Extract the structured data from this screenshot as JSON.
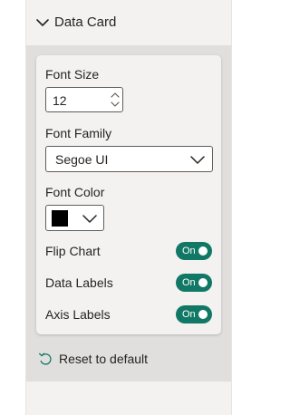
{
  "section": {
    "title": "Data Card",
    "expanded": true
  },
  "font_size": {
    "label": "Font Size",
    "value": "12"
  },
  "font_family": {
    "label": "Font Family",
    "value": "Segoe UI"
  },
  "font_color": {
    "label": "Font Color",
    "color": "#000000"
  },
  "toggles": [
    {
      "label": "Flip Chart",
      "state": "On",
      "checked": true
    },
    {
      "label": "Data Labels",
      "state": "On",
      "checked": true
    },
    {
      "label": "Axis Labels",
      "state": "On",
      "checked": true
    }
  ],
  "reset": {
    "label": "Reset to default"
  },
  "colors": {
    "toggle_on": "#117865",
    "pane_background": "#f3f2f1",
    "section_background": "#e1dfdd",
    "reset_icon": "#117865"
  }
}
